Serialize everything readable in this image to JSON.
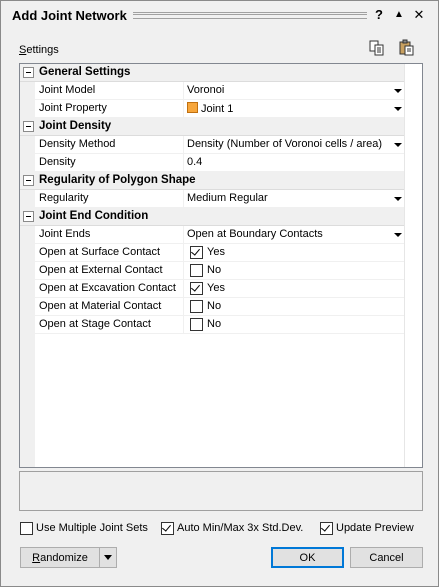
{
  "window": {
    "title": "Add Joint Network",
    "help_glyph": "?",
    "collapse_glyph": "▲",
    "close_glyph": "✕"
  },
  "settings_label": "Settings",
  "groups": [
    {
      "title": "General Settings",
      "props": [
        {
          "name": "Joint Model",
          "value": "Voronoi",
          "dropdown": true
        },
        {
          "name": "Joint Property",
          "value": "Joint 1",
          "dropdown": true,
          "swatch": "#f7a63b"
        }
      ]
    },
    {
      "title": "Joint Density",
      "props": [
        {
          "name": "Density Method",
          "value": "Density (Number of Voronoi cells /  area)",
          "dropdown": true
        },
        {
          "name": "Density",
          "value": "0.4",
          "dropdown": false
        }
      ]
    },
    {
      "title": "Regularity of Polygon Shape",
      "props": [
        {
          "name": "Regularity",
          "value": "Medium Regular",
          "dropdown": true
        }
      ]
    },
    {
      "title": "Joint End Condition",
      "props": [
        {
          "name": "Joint Ends",
          "value": "Open at Boundary Contacts",
          "dropdown": true
        },
        {
          "name": "Open at Surface Contact",
          "value": "Yes",
          "checkbox": true,
          "checked": true
        },
        {
          "name": "Open at External Contact",
          "value": "No",
          "checkbox": true,
          "checked": false
        },
        {
          "name": "Open at Excavation Contact",
          "value": "Yes",
          "checkbox": true,
          "checked": true
        },
        {
          "name": "Open at Material Contact",
          "value": "No",
          "checkbox": true,
          "checked": false
        },
        {
          "name": "Open at Stage Contact",
          "value": "No",
          "checkbox": true,
          "checked": false
        }
      ]
    }
  ],
  "options": {
    "multiple_sets": {
      "label": "Use Multiple Joint Sets",
      "checked": false
    },
    "auto_minmax": {
      "label": "Auto Min/Max 3x Std.Dev.",
      "checked": true
    },
    "update_preview": {
      "label": "Update Preview",
      "checked": true
    }
  },
  "buttons": {
    "randomize": "Randomize",
    "ok": "OK",
    "cancel": "Cancel"
  }
}
